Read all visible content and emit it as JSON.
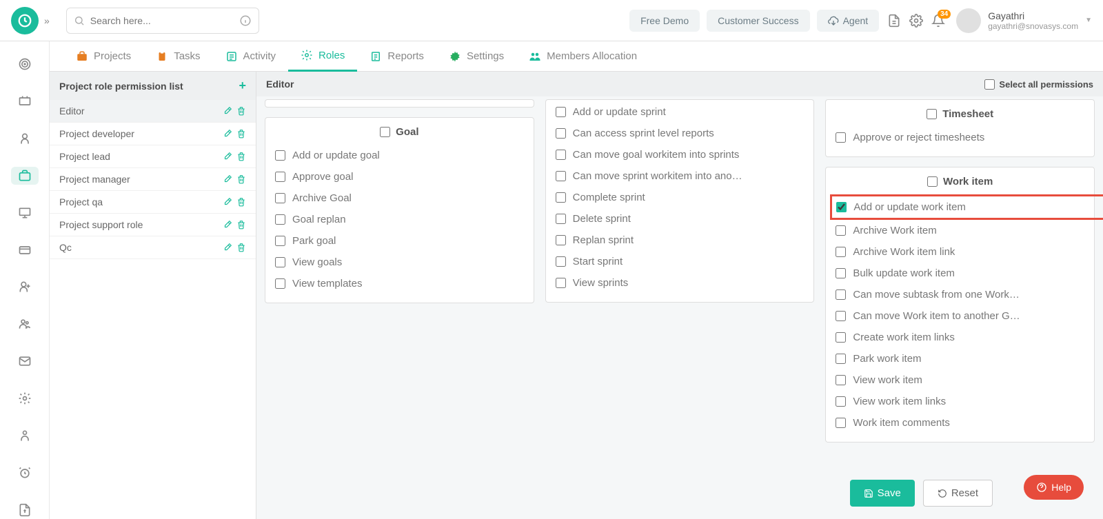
{
  "header": {
    "search_placeholder": "Search here...",
    "free_demo": "Free Demo",
    "customer_success": "Customer Success",
    "agent": "Agent",
    "notification_count": "34",
    "user_name": "Gayathri",
    "user_email": "gayathri@snovasys.com"
  },
  "tabs": [
    {
      "label": "Projects",
      "icon": "briefcase"
    },
    {
      "label": "Tasks",
      "icon": "clipboard"
    },
    {
      "label": "Activity",
      "icon": "list"
    },
    {
      "label": "Roles",
      "icon": "gear",
      "active": true
    },
    {
      "label": "Reports",
      "icon": "report"
    },
    {
      "label": "Settings",
      "icon": "gear-green"
    },
    {
      "label": "Members Allocation",
      "icon": "people"
    }
  ],
  "role_panel": {
    "title": "Project role permission list",
    "roles": [
      {
        "name": "Editor",
        "selected": true
      },
      {
        "name": "Project developer"
      },
      {
        "name": "Project lead"
      },
      {
        "name": "Project manager"
      },
      {
        "name": "Project qa"
      },
      {
        "name": "Project support role"
      },
      {
        "name": "Qc"
      }
    ]
  },
  "editor": {
    "title": "Editor",
    "select_all": "Select all permissions"
  },
  "groups": {
    "goal": {
      "title": "Goal",
      "items": [
        "Add or update goal",
        "Approve goal",
        "Archive Goal",
        "Goal replan",
        "Park goal",
        "View goals",
        "View templates"
      ]
    },
    "sprint": {
      "items": [
        "Add or update sprint",
        "Can access sprint level reports",
        "Can move goal workitem into sprints",
        "Can move sprint workitem into ano…",
        "Complete sprint",
        "Delete sprint",
        "Replan sprint",
        "Start sprint",
        "View sprints"
      ]
    },
    "timesheet": {
      "title": "Timesheet",
      "items": [
        "Approve or reject timesheets"
      ]
    },
    "workitem": {
      "title": "Work item",
      "items": [
        {
          "label": "Add or update work item",
          "checked": true,
          "highlighted": true
        },
        {
          "label": "Archive Work item"
        },
        {
          "label": "Archive Work item link"
        },
        {
          "label": "Bulk update work item"
        },
        {
          "label": "Can move subtask from one Work…"
        },
        {
          "label": "Can move Work item to another G…"
        },
        {
          "label": "Create work item links"
        },
        {
          "label": "Park work item"
        },
        {
          "label": "View work item"
        },
        {
          "label": "View work item links"
        },
        {
          "label": "Work item comments"
        }
      ]
    }
  },
  "footer": {
    "save": "Save",
    "reset": "Reset",
    "help": "Help"
  }
}
